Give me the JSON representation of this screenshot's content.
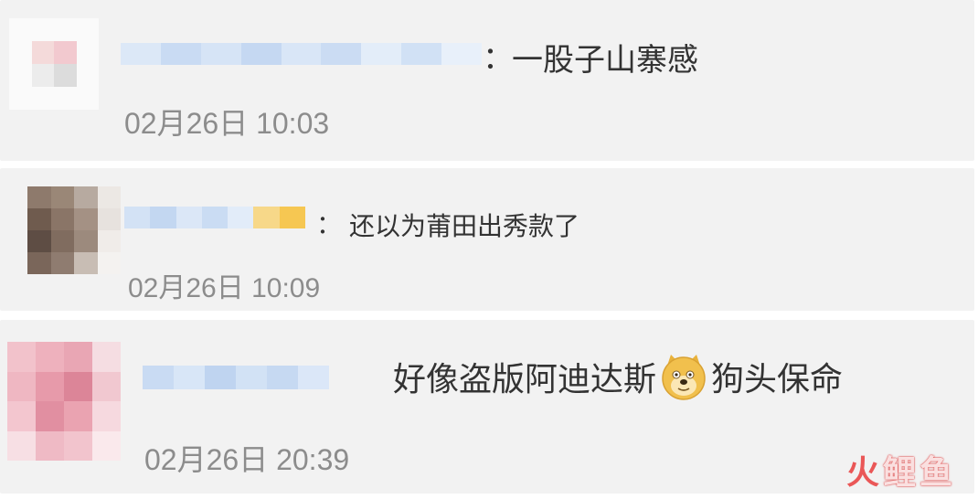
{
  "comments": [
    {
      "content": "一股子山寨感",
      "time": "02月26日 10:03"
    },
    {
      "content": "还以为莆田出秀款了",
      "time": "02月26日 10:09"
    },
    {
      "content_before": "好像盗版阿迪达斯",
      "emoji_icon": "doge-emoji-icon",
      "content_after": "狗头保命",
      "time": "02月26日 20:39"
    }
  ],
  "separator": "：",
  "watermark": {
    "part1": "火",
    "part2": "鲤鱼"
  },
  "colors": {
    "card_background": "#f2f2f2",
    "text": "#333333",
    "timestamp": "#8c8c8c",
    "username_blur": "#cfe0f5",
    "watermark": "#e93c3c"
  }
}
